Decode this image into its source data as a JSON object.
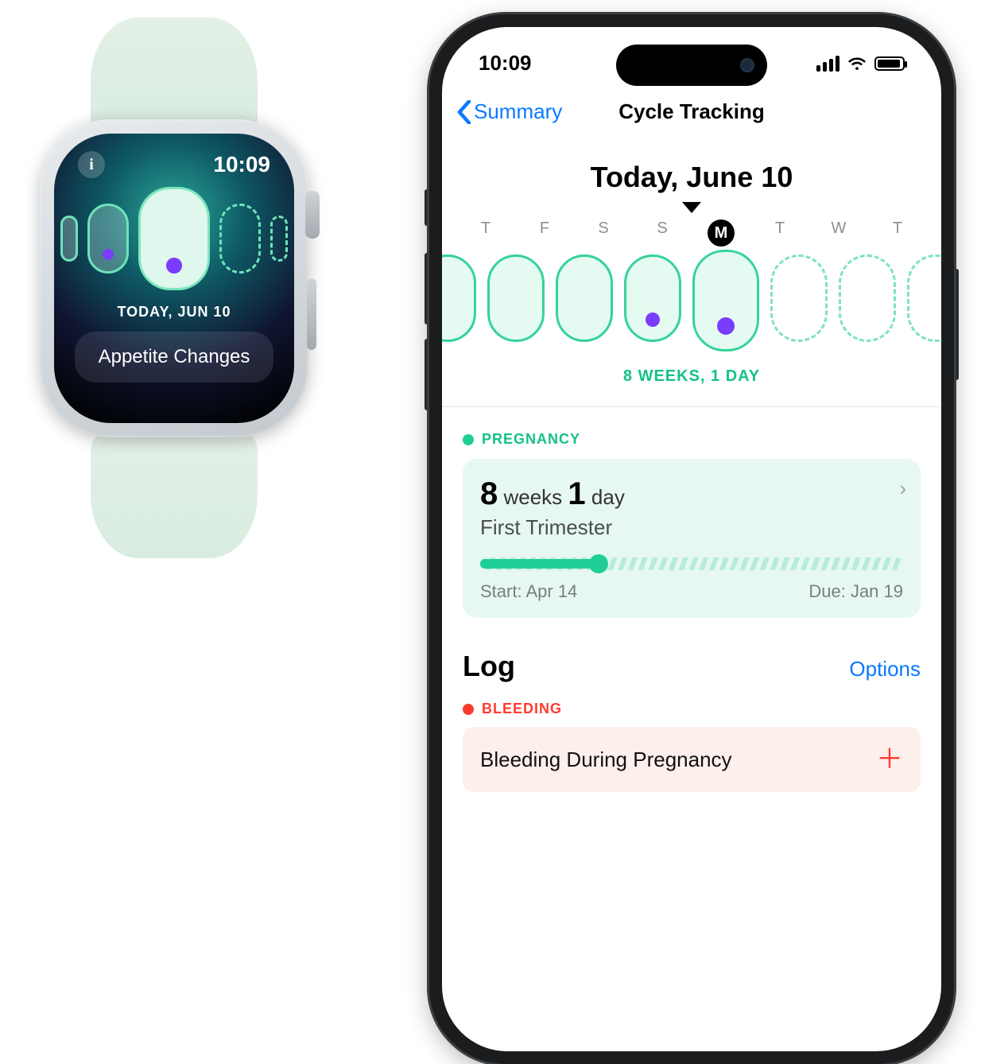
{
  "watch": {
    "time": "10:09",
    "info_symbol": "i",
    "date_label": "TODAY, JUN 10",
    "symptom_chip": "Appetite Changes",
    "days": [
      {
        "style": "sm",
        "dashed": false,
        "dot": false
      },
      {
        "style": "med",
        "dashed": false,
        "dot": true
      },
      {
        "style": "today",
        "dashed": false,
        "dot": true
      },
      {
        "style": "med",
        "dashed": true,
        "dot": false
      },
      {
        "style": "sm",
        "dashed": true,
        "dot": false
      }
    ]
  },
  "phone": {
    "status_time": "10:09",
    "nav_back": "Summary",
    "nav_title": "Cycle Tracking",
    "today_heading": "Today, June 10",
    "dow": [
      "T",
      "F",
      "S",
      "S",
      "M",
      "T",
      "W",
      "T"
    ],
    "today_index": 4,
    "day_pills": [
      {
        "logged": true,
        "today": false,
        "dot": false
      },
      {
        "logged": true,
        "today": false,
        "dot": false
      },
      {
        "logged": true,
        "today": false,
        "dot": false
      },
      {
        "logged": true,
        "today": false,
        "dot": true
      },
      {
        "logged": true,
        "today": true,
        "dot": true
      },
      {
        "logged": false,
        "today": false,
        "dot": false
      },
      {
        "logged": false,
        "today": false,
        "dot": false
      },
      {
        "logged": false,
        "today": false,
        "dot": false
      }
    ],
    "gestation_strip": "8 WEEKS, 1 DAY",
    "pregnancy": {
      "section_label": "PREGNANCY",
      "weeks_num": "8",
      "weeks_word": "weeks",
      "days_num": "1",
      "days_word": "day",
      "trimester": "First Trimester",
      "start_label": "Start: Apr 14",
      "due_label": "Due: Jan 19",
      "progress_pct": 28
    },
    "log": {
      "heading": "Log",
      "options_label": "Options",
      "bleeding_section": "BLEEDING",
      "bleeding_item": "Bleeding During Pregnancy"
    }
  }
}
